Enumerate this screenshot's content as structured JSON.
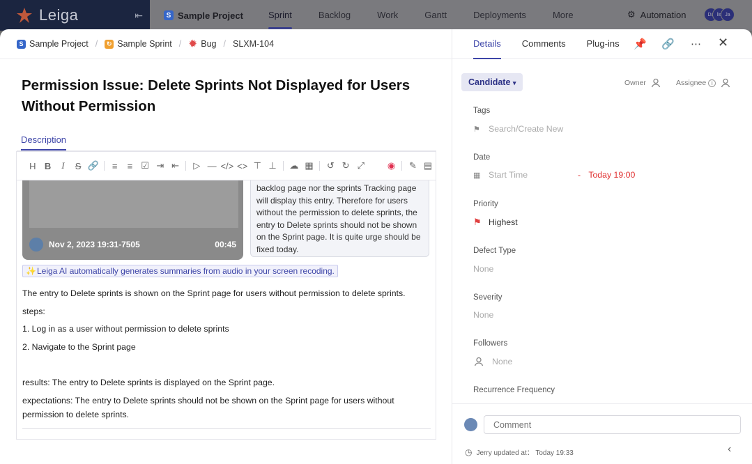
{
  "app": {
    "brand": "Leiga",
    "project": "Sample Project",
    "project_badge": "S"
  },
  "topnav": [
    "Sprint",
    "Backlog",
    "Work",
    "Gantt",
    "Deployments",
    "More"
  ],
  "topnav_active": "Sprint",
  "automation_label": "Automation",
  "avatars": [
    "Da",
    "lis",
    "Ja"
  ],
  "breadcrumb": {
    "project": "Sample Project",
    "sprint": "Sample Sprint",
    "type": "Bug",
    "issue_id": "SLXM-104"
  },
  "issue": {
    "title": "Permission Issue: Delete Sprints Not Displayed for Users Without Permission",
    "description_tab": "Description"
  },
  "video": {
    "label": "Nov 2, 2023 19:31-7505",
    "duration": "00:45"
  },
  "summary_text": "backlog page nor the sprints Tracking page will display this entry. Therefore for users without the permission to delete sprints, the entry to Delete sprints should not be shown on the Sprint page. It is quite urge should be fixed today.",
  "ai_note": "Leiga AI automatically generates summaries from audio in your screen recoding.",
  "description": {
    "p1": "The entry to Delete sprints is shown on the Sprint page for users without permission to delete sprints.",
    "p2": "steps:",
    "p3": "1. Log in as a user without permission to delete sprints",
    "p4": "2. Navigate to the Sprint page",
    "p5": "results: The entry to Delete sprints is displayed on the Sprint page.",
    "p6": "expectations: The entry to Delete sprints should not be shown on the Sprint page for users without",
    "p7": "permission to delete sprints."
  },
  "right_tabs": {
    "details": "Details",
    "comments": "Comments",
    "plugins": "Plug-ins"
  },
  "status": "Candidate",
  "owner_label": "Owner",
  "assignee_label": "Assignee",
  "fields": {
    "tags": {
      "label": "Tags",
      "placeholder": "Search/Create New"
    },
    "date": {
      "label": "Date",
      "start": "Start Time",
      "dash": "-",
      "end": "Today 19:00"
    },
    "priority": {
      "label": "Priority",
      "value": "Highest"
    },
    "defect_type": {
      "label": "Defect Type",
      "value": "None"
    },
    "severity": {
      "label": "Severity",
      "value": "None"
    },
    "followers": {
      "label": "Followers",
      "value": "None"
    },
    "recurrence": {
      "label": "Recurrence Frequency"
    }
  },
  "comment": {
    "placeholder": "Comment"
  },
  "updated_by": "Jerry updated at： Today 19:33",
  "colors": {
    "accent": "#3d45a8",
    "danger": "#e03030",
    "brand_dark": "#1b2540"
  }
}
